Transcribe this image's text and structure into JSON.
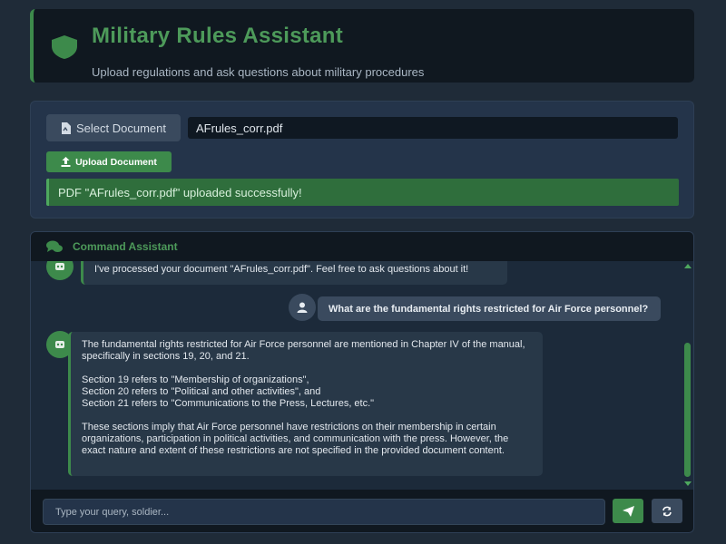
{
  "header": {
    "title": "Military Rules Assistant",
    "subtitle": "Upload regulations and ask questions about military procedures",
    "icon": "shield-icon"
  },
  "upload": {
    "select_label": "Select Document",
    "file_name": "AFrules_corr.pdf",
    "upload_label": "Upload Document",
    "success_message": "PDF \"AFrules_corr.pdf\" uploaded successfully!"
  },
  "chat": {
    "title": "Command Assistant",
    "messages": [
      {
        "role": "bot",
        "text": "I've processed your document \"AFrules_corr.pdf\". Feel free to ask questions about it!"
      },
      {
        "role": "user",
        "text": "What are the fundamental rights restricted for Air Force personnel?"
      },
      {
        "role": "bot",
        "paragraphs": [
          "The fundamental rights restricted for Air Force personnel are mentioned in Chapter IV of the manual, specifically in sections 19, 20, and 21.",
          "Section 19 refers to \"Membership of organizations\",",
          "Section 20 refers to \"Political and other activities\", and",
          "Section 21 refers to \"Communications to the Press, Lectures, etc.\"",
          "These sections imply that Air Force personnel have restrictions on their membership in certain organizations, participation in political activities, and communication with the press. However, the exact nature and extent of these restrictions are not specified in the provided document content."
        ]
      }
    ],
    "input_placeholder": "Type your query, soldier...",
    "input_value": ""
  },
  "colors": {
    "accent": "#3d8a4b",
    "background": "#1f2b38",
    "panel": "#24344a"
  }
}
